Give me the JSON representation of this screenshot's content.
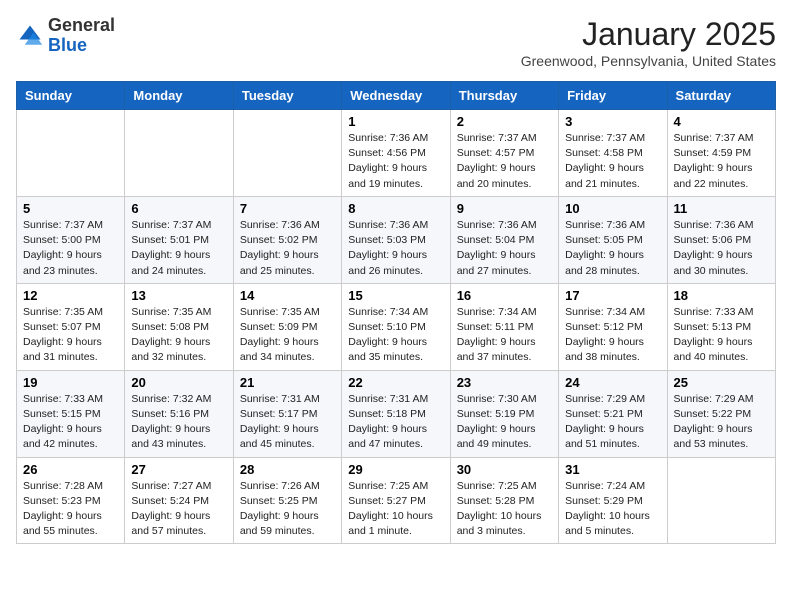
{
  "header": {
    "logo_general": "General",
    "logo_blue": "Blue",
    "title": "January 2025",
    "subtitle": "Greenwood, Pennsylvania, United States"
  },
  "weekdays": [
    "Sunday",
    "Monday",
    "Tuesday",
    "Wednesday",
    "Thursday",
    "Friday",
    "Saturday"
  ],
  "weeks": [
    [
      {
        "day": "",
        "info": ""
      },
      {
        "day": "",
        "info": ""
      },
      {
        "day": "",
        "info": ""
      },
      {
        "day": "1",
        "info": "Sunrise: 7:36 AM\nSunset: 4:56 PM\nDaylight: 9 hours\nand 19 minutes."
      },
      {
        "day": "2",
        "info": "Sunrise: 7:37 AM\nSunset: 4:57 PM\nDaylight: 9 hours\nand 20 minutes."
      },
      {
        "day": "3",
        "info": "Sunrise: 7:37 AM\nSunset: 4:58 PM\nDaylight: 9 hours\nand 21 minutes."
      },
      {
        "day": "4",
        "info": "Sunrise: 7:37 AM\nSunset: 4:59 PM\nDaylight: 9 hours\nand 22 minutes."
      }
    ],
    [
      {
        "day": "5",
        "info": "Sunrise: 7:37 AM\nSunset: 5:00 PM\nDaylight: 9 hours\nand 23 minutes."
      },
      {
        "day": "6",
        "info": "Sunrise: 7:37 AM\nSunset: 5:01 PM\nDaylight: 9 hours\nand 24 minutes."
      },
      {
        "day": "7",
        "info": "Sunrise: 7:36 AM\nSunset: 5:02 PM\nDaylight: 9 hours\nand 25 minutes."
      },
      {
        "day": "8",
        "info": "Sunrise: 7:36 AM\nSunset: 5:03 PM\nDaylight: 9 hours\nand 26 minutes."
      },
      {
        "day": "9",
        "info": "Sunrise: 7:36 AM\nSunset: 5:04 PM\nDaylight: 9 hours\nand 27 minutes."
      },
      {
        "day": "10",
        "info": "Sunrise: 7:36 AM\nSunset: 5:05 PM\nDaylight: 9 hours\nand 28 minutes."
      },
      {
        "day": "11",
        "info": "Sunrise: 7:36 AM\nSunset: 5:06 PM\nDaylight: 9 hours\nand 30 minutes."
      }
    ],
    [
      {
        "day": "12",
        "info": "Sunrise: 7:35 AM\nSunset: 5:07 PM\nDaylight: 9 hours\nand 31 minutes."
      },
      {
        "day": "13",
        "info": "Sunrise: 7:35 AM\nSunset: 5:08 PM\nDaylight: 9 hours\nand 32 minutes."
      },
      {
        "day": "14",
        "info": "Sunrise: 7:35 AM\nSunset: 5:09 PM\nDaylight: 9 hours\nand 34 minutes."
      },
      {
        "day": "15",
        "info": "Sunrise: 7:34 AM\nSunset: 5:10 PM\nDaylight: 9 hours\nand 35 minutes."
      },
      {
        "day": "16",
        "info": "Sunrise: 7:34 AM\nSunset: 5:11 PM\nDaylight: 9 hours\nand 37 minutes."
      },
      {
        "day": "17",
        "info": "Sunrise: 7:34 AM\nSunset: 5:12 PM\nDaylight: 9 hours\nand 38 minutes."
      },
      {
        "day": "18",
        "info": "Sunrise: 7:33 AM\nSunset: 5:13 PM\nDaylight: 9 hours\nand 40 minutes."
      }
    ],
    [
      {
        "day": "19",
        "info": "Sunrise: 7:33 AM\nSunset: 5:15 PM\nDaylight: 9 hours\nand 42 minutes."
      },
      {
        "day": "20",
        "info": "Sunrise: 7:32 AM\nSunset: 5:16 PM\nDaylight: 9 hours\nand 43 minutes."
      },
      {
        "day": "21",
        "info": "Sunrise: 7:31 AM\nSunset: 5:17 PM\nDaylight: 9 hours\nand 45 minutes."
      },
      {
        "day": "22",
        "info": "Sunrise: 7:31 AM\nSunset: 5:18 PM\nDaylight: 9 hours\nand 47 minutes."
      },
      {
        "day": "23",
        "info": "Sunrise: 7:30 AM\nSunset: 5:19 PM\nDaylight: 9 hours\nand 49 minutes."
      },
      {
        "day": "24",
        "info": "Sunrise: 7:29 AM\nSunset: 5:21 PM\nDaylight: 9 hours\nand 51 minutes."
      },
      {
        "day": "25",
        "info": "Sunrise: 7:29 AM\nSunset: 5:22 PM\nDaylight: 9 hours\nand 53 minutes."
      }
    ],
    [
      {
        "day": "26",
        "info": "Sunrise: 7:28 AM\nSunset: 5:23 PM\nDaylight: 9 hours\nand 55 minutes."
      },
      {
        "day": "27",
        "info": "Sunrise: 7:27 AM\nSunset: 5:24 PM\nDaylight: 9 hours\nand 57 minutes."
      },
      {
        "day": "28",
        "info": "Sunrise: 7:26 AM\nSunset: 5:25 PM\nDaylight: 9 hours\nand 59 minutes."
      },
      {
        "day": "29",
        "info": "Sunrise: 7:25 AM\nSunset: 5:27 PM\nDaylight: 10 hours\nand 1 minute."
      },
      {
        "day": "30",
        "info": "Sunrise: 7:25 AM\nSunset: 5:28 PM\nDaylight: 10 hours\nand 3 minutes."
      },
      {
        "day": "31",
        "info": "Sunrise: 7:24 AM\nSunset: 5:29 PM\nDaylight: 10 hours\nand 5 minutes."
      },
      {
        "day": "",
        "info": ""
      }
    ]
  ]
}
